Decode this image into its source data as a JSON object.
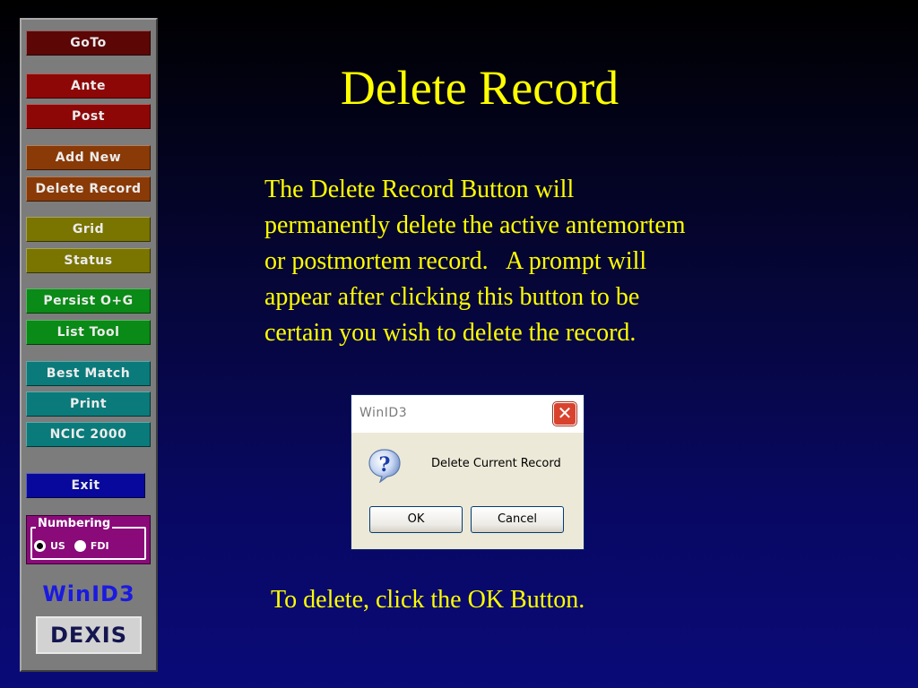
{
  "sidebar": {
    "buttons": [
      {
        "label": "GoTo",
        "color": "#5c0606"
      },
      {
        "label": "Ante",
        "color": "#8e0707"
      },
      {
        "label": "Post",
        "color": "#8e0707"
      },
      {
        "label": "Add New",
        "color": "#8a3a06"
      },
      {
        "label": "Delete Record",
        "color": "#8a3a06"
      },
      {
        "label": "Grid",
        "color": "#7a7400"
      },
      {
        "label": "Status",
        "color": "#7a7400"
      },
      {
        "label": "Persist O+G",
        "color": "#0a8a16"
      },
      {
        "label": "List Tool",
        "color": "#0a8a16"
      },
      {
        "label": "Best Match",
        "color": "#0b7a7a"
      },
      {
        "label": "Print",
        "color": "#0b7a7a"
      },
      {
        "label": "NCIC 2000",
        "color": "#0b7a7a"
      },
      {
        "label": "Exit",
        "color": "#08089c"
      }
    ],
    "numbering": {
      "legend": "Numbering",
      "options": [
        {
          "label": "US",
          "selected": true
        },
        {
          "label": "FDI",
          "selected": false
        }
      ]
    },
    "brand": "WinID3",
    "logo": "DEXIS"
  },
  "main": {
    "title": "Delete Record",
    "body": "The Delete Record Button will\npermanently delete the active antemortem\nor postmortem record.   A prompt will\nappear after clicking this button to be\ncertain you wish to delete the record.",
    "footer": "To delete, click the OK Button."
  },
  "dialog": {
    "title": "WinID3",
    "close_glyph": "✕",
    "icon": "question-icon",
    "message": "Delete Current Record",
    "ok_label": "OK",
    "cancel_label": "Cancel"
  },
  "colors": {
    "text_accent": "#ffff00",
    "background_top": "#000000",
    "background_bottom": "#0a0a78"
  }
}
